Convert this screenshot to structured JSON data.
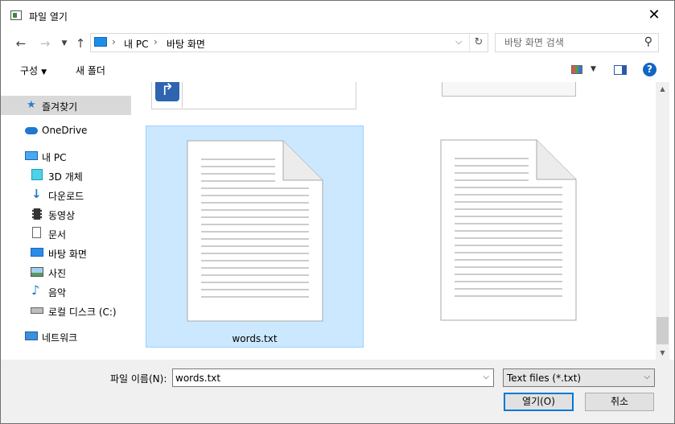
{
  "window": {
    "title": "파일 열기",
    "close_label": "✕"
  },
  "address": {
    "crumbs": [
      "내 PC",
      "바탕 화면"
    ],
    "search_placeholder": "바탕 화면 검색"
  },
  "toolbar": {
    "organize": "구성",
    "new_folder": "새 폴더"
  },
  "nav": {
    "quick_access": "즐겨찾기",
    "onedrive": "OneDrive",
    "this_pc": "내 PC",
    "objects3d": "3D 개체",
    "downloads": "다운로드",
    "videos": "동영상",
    "documents": "문서",
    "desktop": "바탕 화면",
    "pictures": "사진",
    "music": "음악",
    "local_disk": "로컬 디스크 (C:)",
    "network": "네트워크"
  },
  "files": [
    {
      "name": "words.txt",
      "selected": true
    },
    {
      "name": "",
      "selected": false
    }
  ],
  "bottom": {
    "filename_label": "파일 이름(N):",
    "filename_value": "words.txt",
    "filetype_value": "Text files (*.txt)",
    "open_button": "열기(O)",
    "cancel_button": "취소"
  }
}
